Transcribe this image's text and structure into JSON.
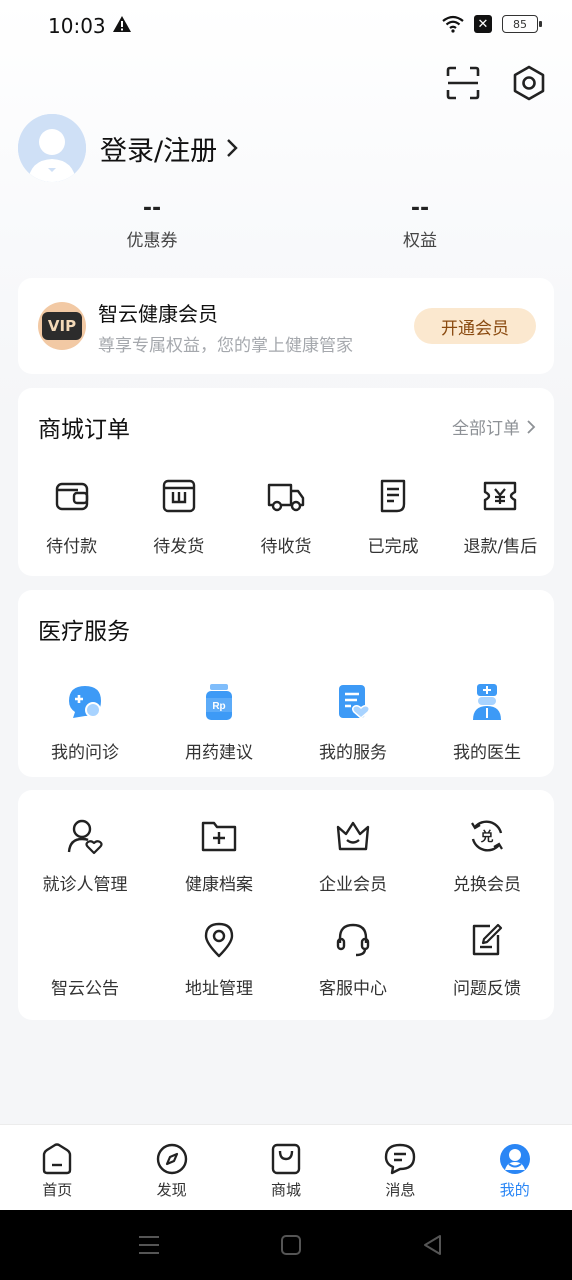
{
  "status_bar": {
    "time": "10:03",
    "battery": "85"
  },
  "profile": {
    "login_label": "登录/注册"
  },
  "stats": [
    {
      "value": "--",
      "label": "优惠券"
    },
    {
      "value": "--",
      "label": "权益"
    }
  ],
  "vip": {
    "badge": "VIP",
    "title": "智云健康会员",
    "subtitle": "尊享专属权益，您的掌上健康管家",
    "button": "开通会员"
  },
  "orders": {
    "title": "商城订单",
    "all_label": "全部订单",
    "items": [
      {
        "label": "待付款",
        "icon": "wallet-icon"
      },
      {
        "label": "待发货",
        "icon": "package-icon"
      },
      {
        "label": "待收货",
        "icon": "truck-icon"
      },
      {
        "label": "已完成",
        "icon": "document-icon"
      },
      {
        "label": "退款/售后",
        "icon": "refund-icon"
      }
    ]
  },
  "medical": {
    "title": "医疗服务",
    "items": [
      {
        "label": "我的问诊",
        "icon": "consult-chat-icon"
      },
      {
        "label": "用药建议",
        "icon": "medicine-bottle-icon"
      },
      {
        "label": "我的服务",
        "icon": "service-doc-icon"
      },
      {
        "label": "我的医生",
        "icon": "doctor-icon"
      }
    ],
    "rx_text": "Rp"
  },
  "tools": {
    "items": [
      {
        "label": "就诊人管理",
        "icon": "patient-heart-icon"
      },
      {
        "label": "健康档案",
        "icon": "health-folder-icon"
      },
      {
        "label": "企业会员",
        "icon": "crown-icon"
      },
      {
        "label": "兑换会员",
        "icon": "exchange-icon"
      },
      {
        "label": "智云公告",
        "icon": ""
      },
      {
        "label": "地址管理",
        "icon": "location-pin-icon"
      },
      {
        "label": "客服中心",
        "icon": "headset-icon"
      },
      {
        "label": "问题反馈",
        "icon": "feedback-icon"
      }
    ]
  },
  "tabbar": {
    "items": [
      {
        "label": "首页",
        "icon": "home-icon"
      },
      {
        "label": "发现",
        "icon": "compass-icon"
      },
      {
        "label": "商城",
        "icon": "shopping-bag-icon"
      },
      {
        "label": "消息",
        "icon": "message-icon"
      },
      {
        "label": "我的",
        "icon": "profile-icon"
      }
    ],
    "active_color": "#2a86f5"
  },
  "colors": {
    "accent": "#2a86f5",
    "vip_button_bg": "#fbe8cf",
    "vip_button_text": "#8a4a10"
  }
}
